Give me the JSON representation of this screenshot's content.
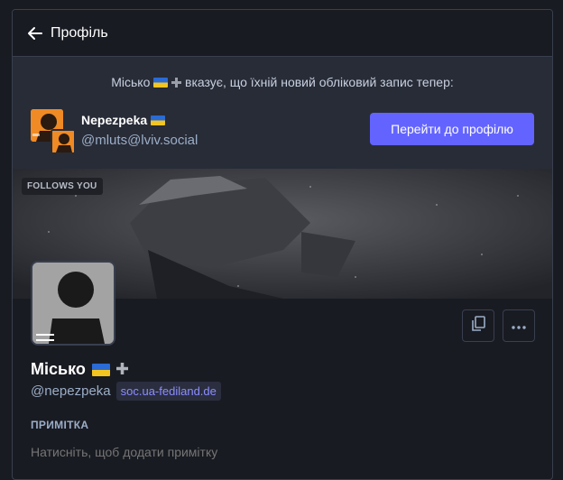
{
  "header": {
    "title": "Профіль"
  },
  "moved": {
    "old_name": "Місько",
    "message_suffix": "вказує, що їхній новий обліковий запис тепер:",
    "new_name": "Nepezpeka",
    "new_handle": "@mluts@lviv.social",
    "goto_label": "Перейти до профілю"
  },
  "cover": {
    "follows_badge": "FOLLOWS YOU"
  },
  "profile": {
    "name": "Місько",
    "handle": "@nepezpeka",
    "domain": "soc.ua-fediland.de"
  },
  "note": {
    "label": "ПРИМІТКА",
    "placeholder": "Натисніть, щоб додати примітку"
  },
  "icons": {
    "back": "arrow-left-icon",
    "flag": "ukraine-flag-icon",
    "cross": "cross-icon",
    "copy": "copy-icon",
    "more": "more-dots-icon"
  },
  "colors": {
    "accent": "#6364ff",
    "background": "#191b22",
    "banner": "#282c37",
    "muted": "#9baec8",
    "domain": "#8c8dff"
  }
}
